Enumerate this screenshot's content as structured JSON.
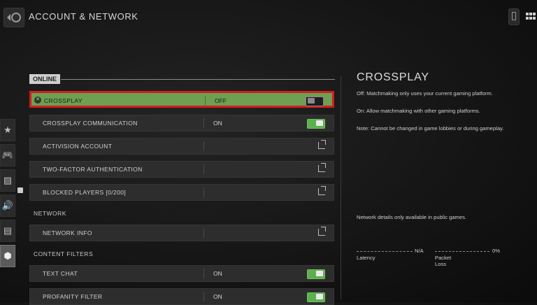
{
  "header": {
    "title": "ACCOUNT & NETWORK"
  },
  "side_rail": [
    {
      "icon": "star-icon",
      "glyph": "★"
    },
    {
      "icon": "gamepad-icon",
      "glyph": "🎮"
    },
    {
      "icon": "graphics-icon",
      "glyph": "▨"
    },
    {
      "icon": "speaker-icon",
      "glyph": "🔊"
    },
    {
      "icon": "interface-icon",
      "glyph": "▤"
    },
    {
      "icon": "network-icon",
      "glyph": "⬢"
    }
  ],
  "sections": {
    "online": "ONLINE",
    "network": "NETWORK",
    "content_filters": "CONTENT FILTERS"
  },
  "rows": {
    "crossplay": {
      "label": "CROSSPLAY",
      "value": "OFF",
      "toggle": "off"
    },
    "crossplay_comm": {
      "label": "CROSSPLAY COMMUNICATION",
      "value": "ON",
      "toggle": "on"
    },
    "activision": {
      "label": "ACTIVISION ACCOUNT"
    },
    "two_factor": {
      "label": "TWO-FACTOR AUTHENTICATION"
    },
    "blocked": {
      "label": "BLOCKED PLAYERS [0/200]"
    },
    "network_info": {
      "label": "NETWORK INFO"
    },
    "text_chat": {
      "label": "TEXT CHAT",
      "value": "ON",
      "toggle": "on"
    },
    "profanity": {
      "label": "PROFANITY FILTER",
      "value": "ON",
      "toggle": "on"
    }
  },
  "details": {
    "title": "CROSSPLAY",
    "line1": "Off: Matchmaking only uses your current gaming platform.",
    "line2": "On: Allow matchmaking with other gaming platforms.",
    "line3": "Note: Cannot be changed in game lobbies or during gameplay.",
    "network_note": "Network details only available in public games.",
    "latency_value": "N/A",
    "latency_label": "Latency",
    "packet_loss_value": "0%",
    "packet_loss_label": "Packet Loss"
  },
  "colors": {
    "selected_row": "#6e9f52",
    "selected_border": "#d31d1d",
    "toggle_on": "#5db04f"
  }
}
